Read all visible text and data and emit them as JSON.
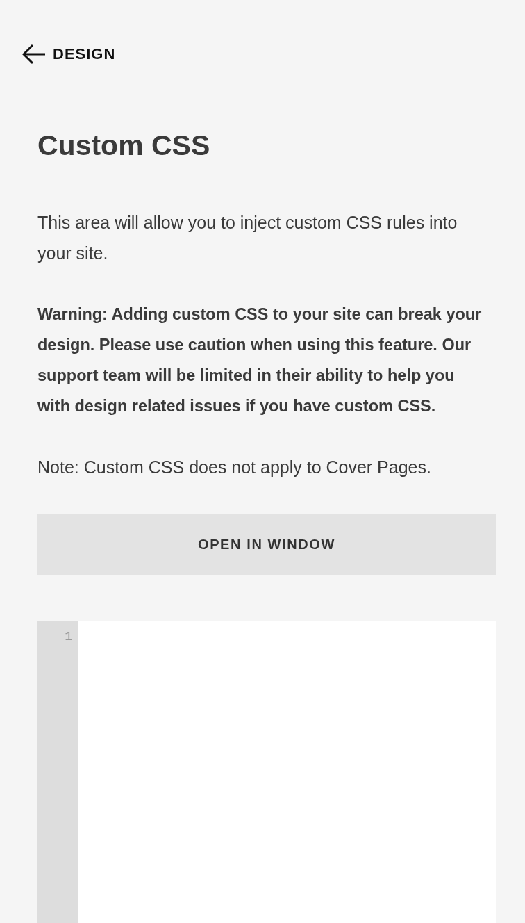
{
  "back_link": {
    "label": "DESIGN"
  },
  "title": "Custom CSS",
  "paragraphs": [
    {
      "kind": "plain",
      "text": "This area will allow you to inject custom CSS rules into your site."
    },
    {
      "kind": "warning",
      "text": "Warning: Adding custom CSS to your site can break your design. Please use caution when using this feature. Our support team will be limited in their ability to help you with design related issues if you have custom CSS."
    },
    {
      "kind": "plain",
      "text": "Note: Custom CSS does not apply to Cover Pages."
    }
  ],
  "open_button": {
    "label": "OPEN IN WINDOW"
  },
  "editor": {
    "line_numbers": [
      "1"
    ]
  }
}
